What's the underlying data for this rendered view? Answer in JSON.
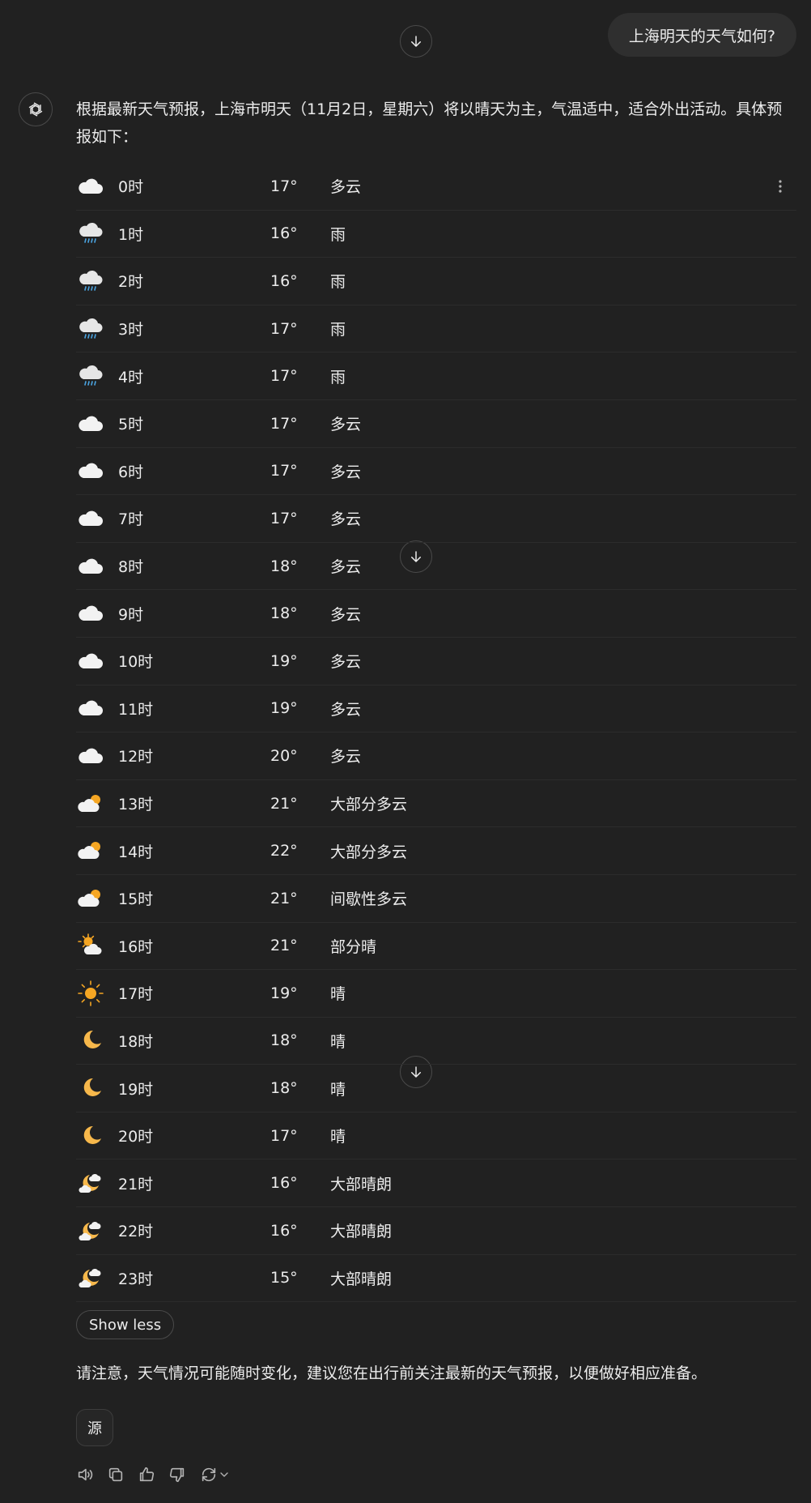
{
  "user_message": "上海明天的天气如何?",
  "assistant": {
    "intro": "根据最新天气预报，上海市明天（11月2日，星期六）将以晴天为主，气温适中，适合外出活动。具体预报如下：",
    "forecast": [
      {
        "hour": "0时",
        "temp": "17°",
        "cond": "多云",
        "icon": "cloud-icon"
      },
      {
        "hour": "1时",
        "temp": "16°",
        "cond": "雨",
        "icon": "rain-icon"
      },
      {
        "hour": "2时",
        "temp": "16°",
        "cond": "雨",
        "icon": "rain-icon"
      },
      {
        "hour": "3时",
        "temp": "17°",
        "cond": "雨",
        "icon": "rain-icon"
      },
      {
        "hour": "4时",
        "temp": "17°",
        "cond": "雨",
        "icon": "rain-icon"
      },
      {
        "hour": "5时",
        "temp": "17°",
        "cond": "多云",
        "icon": "cloud-icon"
      },
      {
        "hour": "6时",
        "temp": "17°",
        "cond": "多云",
        "icon": "cloud-icon"
      },
      {
        "hour": "7时",
        "temp": "17°",
        "cond": "多云",
        "icon": "cloud-icon"
      },
      {
        "hour": "8时",
        "temp": "18°",
        "cond": "多云",
        "icon": "cloud-icon"
      },
      {
        "hour": "9时",
        "temp": "18°",
        "cond": "多云",
        "icon": "cloud-icon"
      },
      {
        "hour": "10时",
        "temp": "19°",
        "cond": "多云",
        "icon": "cloud-icon"
      },
      {
        "hour": "11时",
        "temp": "19°",
        "cond": "多云",
        "icon": "cloud-icon"
      },
      {
        "hour": "12时",
        "temp": "20°",
        "cond": "多云",
        "icon": "cloud-icon"
      },
      {
        "hour": "13时",
        "temp": "21°",
        "cond": "大部分多云",
        "icon": "mostly-cloudy-icon"
      },
      {
        "hour": "14时",
        "temp": "22°",
        "cond": "大部分多云",
        "icon": "mostly-cloudy-icon"
      },
      {
        "hour": "15时",
        "temp": "21°",
        "cond": "间歇性多云",
        "icon": "mostly-cloudy-icon"
      },
      {
        "hour": "16时",
        "temp": "21°",
        "cond": "部分晴",
        "icon": "partly-sunny-icon"
      },
      {
        "hour": "17时",
        "temp": "19°",
        "cond": "晴",
        "icon": "sun-icon"
      },
      {
        "hour": "18时",
        "temp": "18°",
        "cond": "晴",
        "icon": "moon-icon"
      },
      {
        "hour": "19时",
        "temp": "18°",
        "cond": "晴",
        "icon": "moon-icon"
      },
      {
        "hour": "20时",
        "temp": "17°",
        "cond": "晴",
        "icon": "moon-icon"
      },
      {
        "hour": "21时",
        "temp": "16°",
        "cond": "大部晴朗",
        "icon": "moon-cloud-icon"
      },
      {
        "hour": "22时",
        "temp": "16°",
        "cond": "大部晴朗",
        "icon": "moon-cloud-icon"
      },
      {
        "hour": "23时",
        "temp": "15°",
        "cond": "大部晴朗",
        "icon": "moon-cloud-icon"
      }
    ],
    "show_less_label": "Show less",
    "note": "请注意，天气情况可能随时变化，建议您在出行前关注最新的天气预报，以便做好相应准备。",
    "source_label": "源"
  },
  "colors": {
    "background": "#212121",
    "bubble": "#2f2f2f",
    "text": "#ececec",
    "sun": "#f5a623",
    "rain": "#4aa3df"
  }
}
